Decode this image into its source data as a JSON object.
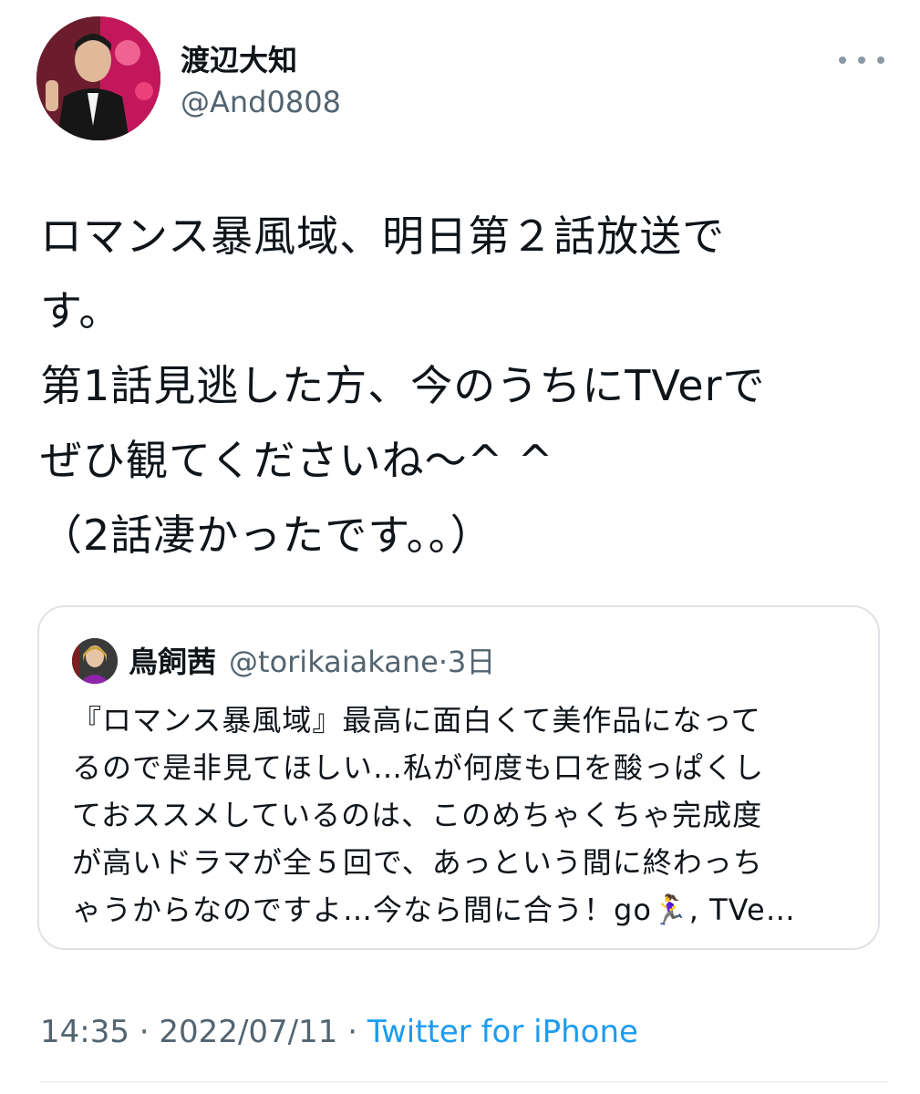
{
  "author": {
    "display_name": "渡辺大知",
    "handle": "@And0808"
  },
  "icons": {
    "more": "more-horizontal-icon"
  },
  "tweet": {
    "text": "ロマンス暴風域、明日第２話放送で\nす。\n第1話見逃した方、今のうちにTVerで\nぜひ観てくださいね〜^ ^\n（2話凄かったです。。）"
  },
  "quoted_tweet": {
    "display_name": "鳥飼茜",
    "handle": "@torikaiakane",
    "separator": "·",
    "time": "3日",
    "text": "『ロマンス暴風域』最高に面白くて美作品になって\nるので是非見てほしい…私が何度も口を酸っぱくし\nておススメしているのは、このめちゃくちゃ完成度\nが高いドラマが全５回で、あっという間に終わっち\nゃうからなのですよ…今なら間に合う！go🏃‍♀️, TVe…"
  },
  "meta": {
    "time": "14:35",
    "separator1": " · ",
    "date": "2022/07/11",
    "separator2": " · ",
    "source": "Twitter for iPhone"
  },
  "colors": {
    "text": "#0f1419",
    "secondary": "#536471",
    "link": "#1d9bf0",
    "border": "#dfe3e7"
  }
}
